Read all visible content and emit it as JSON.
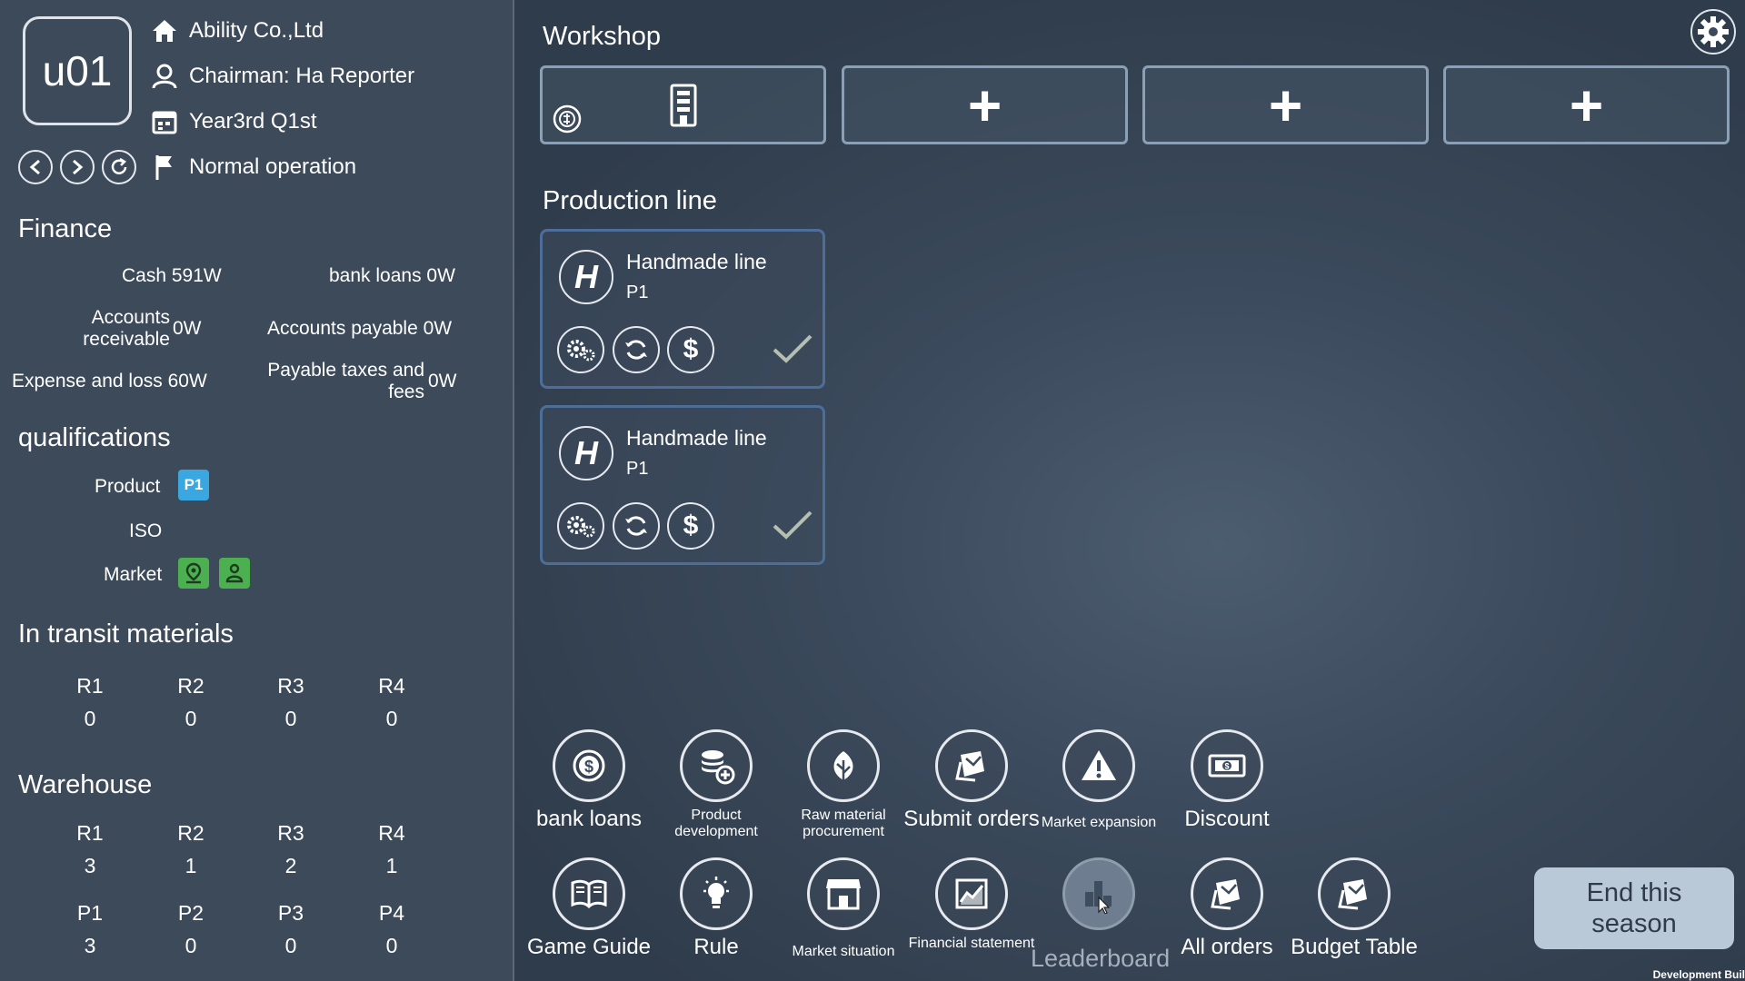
{
  "player": {
    "id": "u01",
    "company": "Ability Co.,Ltd",
    "chairman": "Chairman:  Ha Reporter",
    "period": "Year3rd  Q1st",
    "status": "Normal operation"
  },
  "finance": {
    "title": "Finance",
    "cash_label": "Cash 591W",
    "bank_loans_label": "bank loans 0W",
    "ar_label": "Accounts receivable",
    "ar_value": "0W",
    "ap_label": "Accounts payable 0W",
    "expense_label": "Expense and loss 60W",
    "taxes_label": "Payable taxes and fees",
    "taxes_value": "0W"
  },
  "qualifications": {
    "title": "qualifications",
    "product_label": "Product",
    "product_badge": "P1",
    "iso_label": "ISO",
    "market_label": "Market"
  },
  "transit": {
    "title": "In transit materials",
    "items": [
      {
        "name": "R1",
        "value": "0"
      },
      {
        "name": "R2",
        "value": "0"
      },
      {
        "name": "R3",
        "value": "0"
      },
      {
        "name": "R4",
        "value": "0"
      }
    ]
  },
  "warehouse": {
    "title": "Warehouse",
    "raw": [
      {
        "name": "R1",
        "value": "3"
      },
      {
        "name": "R2",
        "value": "1"
      },
      {
        "name": "R3",
        "value": "2"
      },
      {
        "name": "R4",
        "value": "1"
      }
    ],
    "products": [
      {
        "name": "P1",
        "value": "3"
      },
      {
        "name": "P2",
        "value": "0"
      },
      {
        "name": "P3",
        "value": "0"
      },
      {
        "name": "P4",
        "value": "0"
      }
    ]
  },
  "workshop": {
    "title": "Workshop"
  },
  "production": {
    "title": "Production line",
    "lines": [
      {
        "type_letter": "H",
        "name": "Handmade line",
        "product": "P1"
      },
      {
        "type_letter": "H",
        "name": "Handmade line",
        "product": "P1"
      }
    ]
  },
  "tools": {
    "bank_loans": "bank loans",
    "product_development": "Product development",
    "raw_material": "Raw material procurement",
    "submit_orders": "Submit orders",
    "market_expansion": "Market expansion",
    "discount": "Discount",
    "game_guide": "Game Guide",
    "rule": "Rule",
    "market_situation": "Market situation",
    "financial_statement": "Financial statement",
    "leaderboard": "Leaderboard",
    "all_orders": "All orders",
    "budget_table": "Budget Table"
  },
  "end_season": "End this season",
  "dev_build": "Development Buil",
  "colors": {
    "badge_blue": "#3aa7e0",
    "badge_green": "#4caf50",
    "end_button": "#b9c9d8",
    "card_border": "#4d6e99"
  }
}
